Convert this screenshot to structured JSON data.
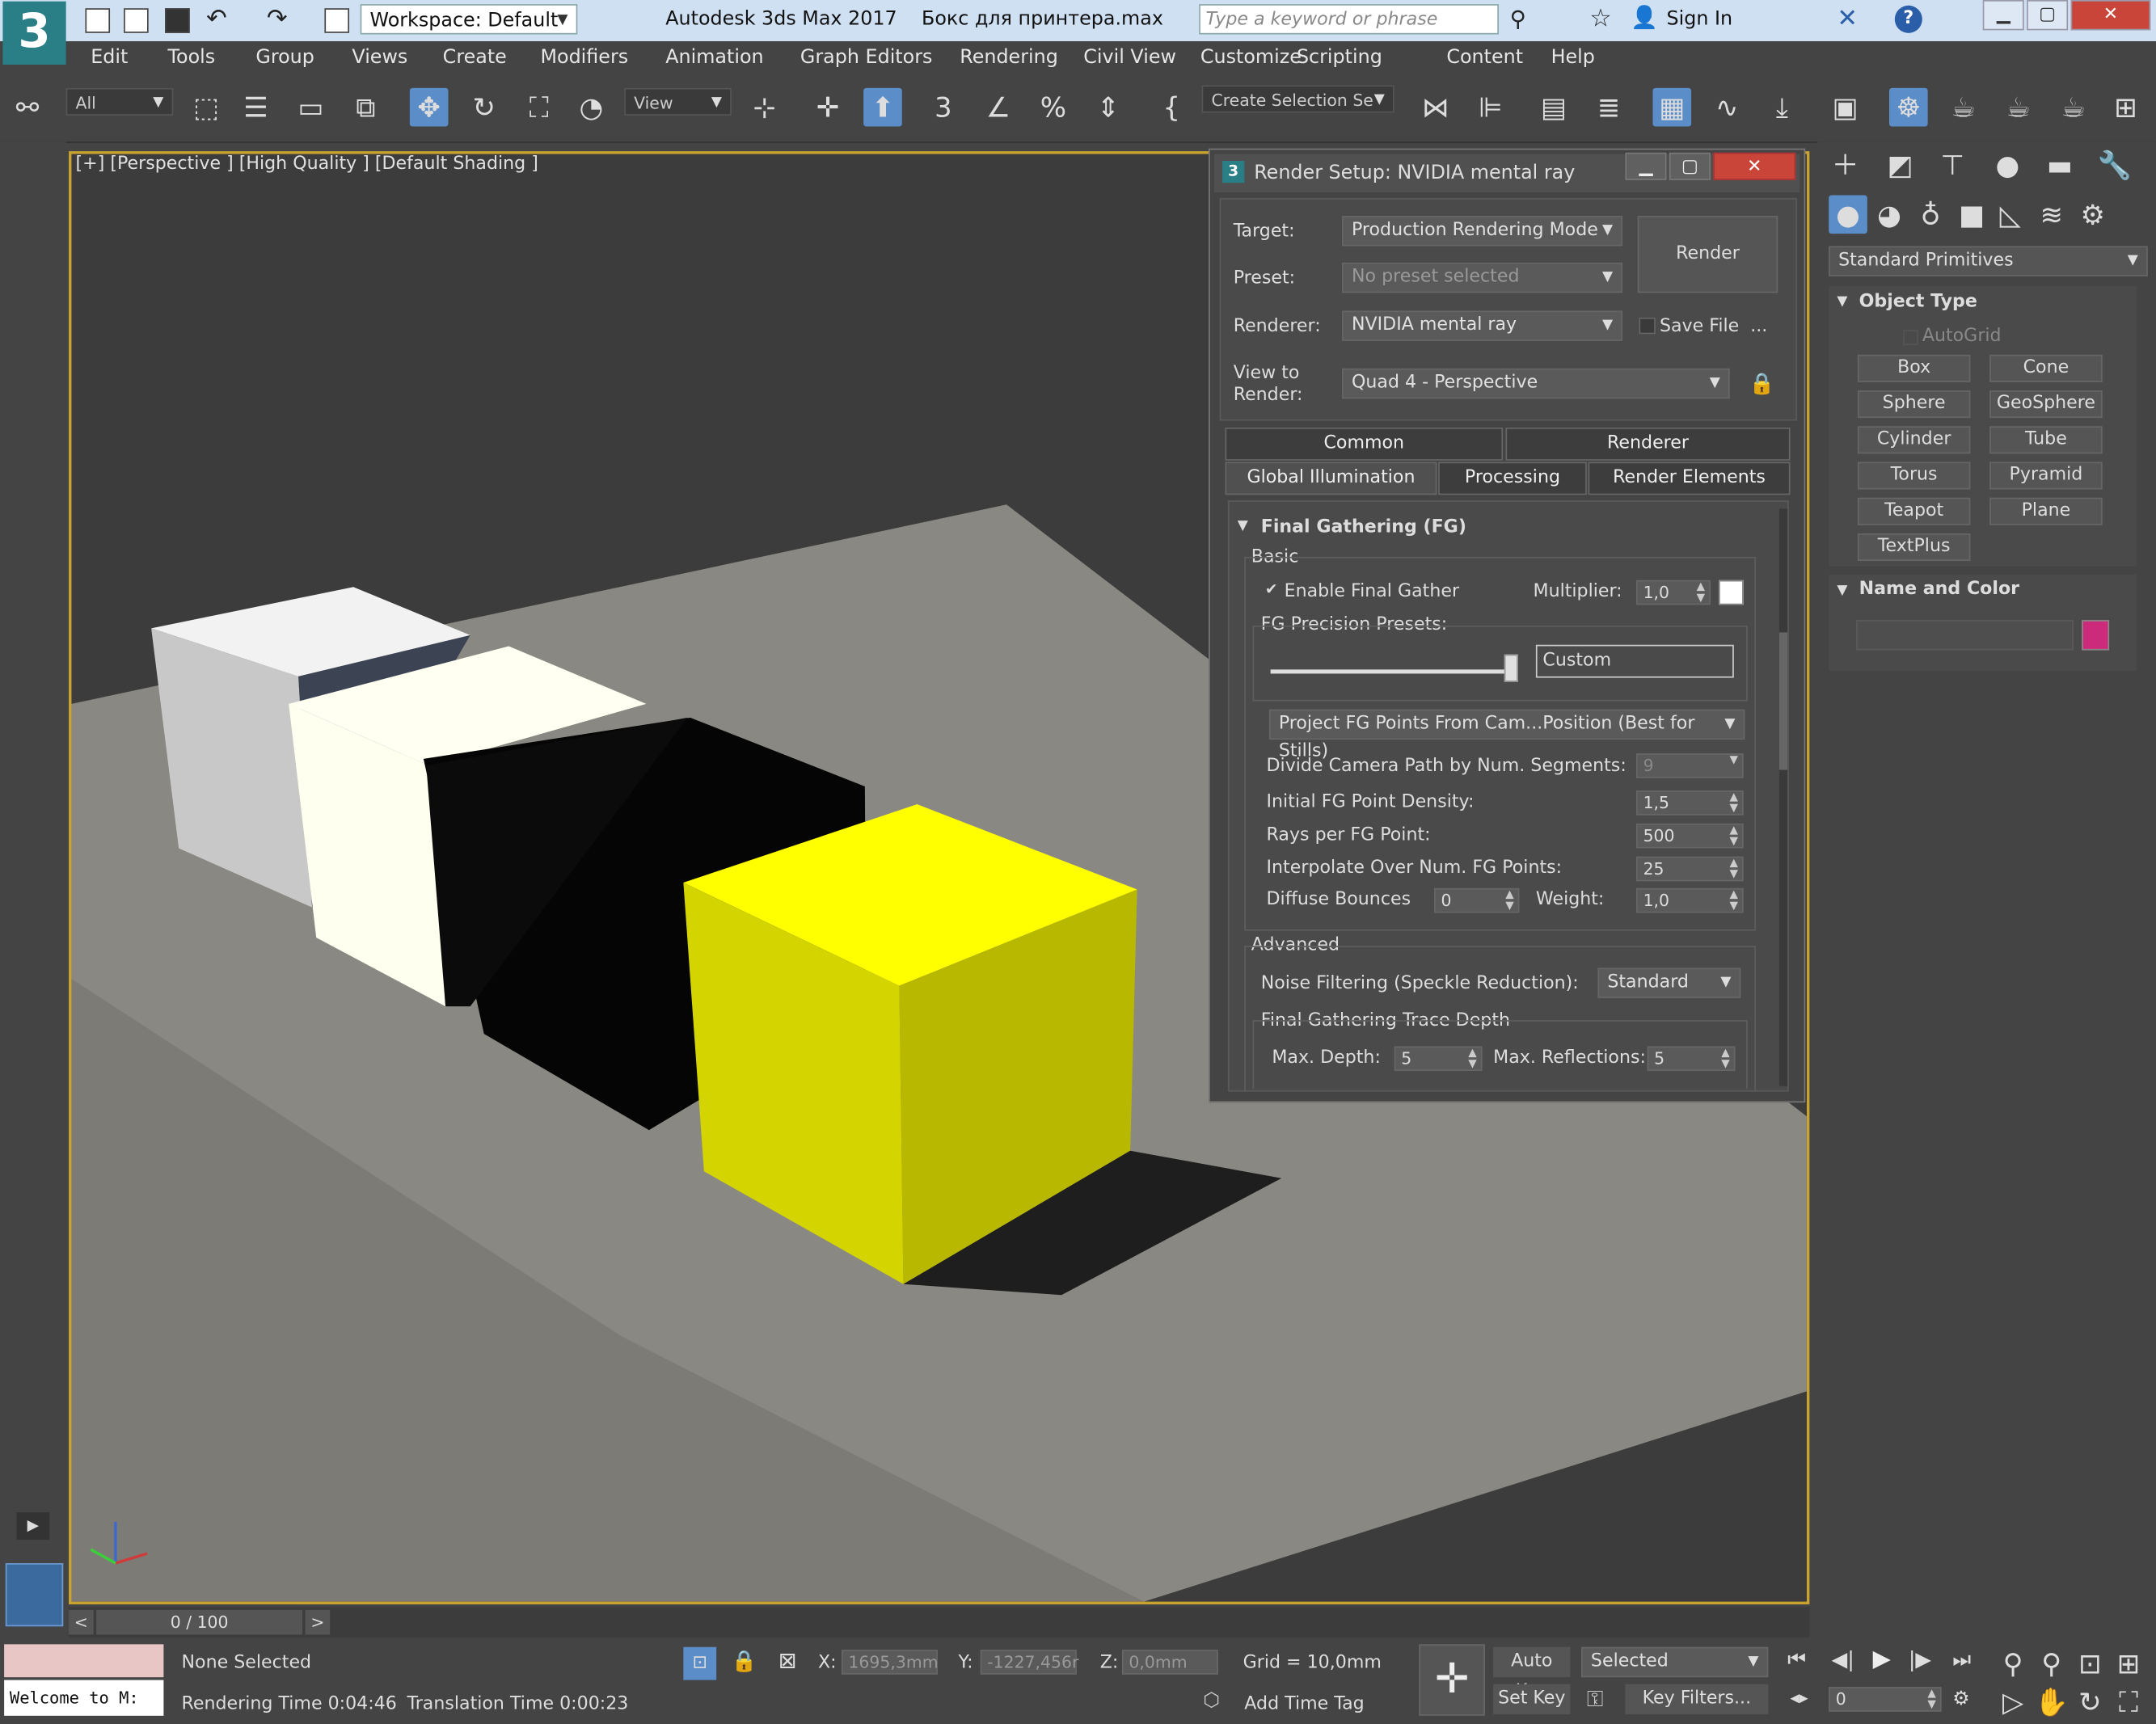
{
  "title_bar": {
    "logo_text": "3",
    "workspace": "Workspace: Default",
    "app_title": "Autodesk 3ds Max 2017",
    "file_title": "Бокс для принтера.max",
    "search_placeholder": "Type a keyword or phrase",
    "sign_in": "Sign In",
    "help": "?"
  },
  "menu": [
    "Edit",
    "Tools",
    "Group",
    "Views",
    "Create",
    "Modifiers",
    "Animation",
    "Graph Editors",
    "Rendering",
    "Civil View",
    "Customize",
    "Scripting",
    "Content",
    "Help"
  ],
  "toolbar": {
    "filter": "All",
    "ref_coord": "View",
    "selection_set": "Create Selection Se"
  },
  "viewport": {
    "label": "[+] [Perspective ] [High Quality ] [Default Shading ]"
  },
  "render_setup": {
    "title": "Render Setup: NVIDIA mental ray",
    "target_label": "Target:",
    "target_value": "Production Rendering Mode",
    "preset_label": "Preset:",
    "preset_value": "No preset selected",
    "renderer_label": "Renderer:",
    "renderer_value": "NVIDIA mental ray",
    "save_file": "Save File",
    "more": "...",
    "view_label_1": "View to",
    "view_label_2": "Render:",
    "view_value": "Quad 4 - Perspective",
    "render_button": "Render",
    "tabs_row1": [
      "Common",
      "Renderer"
    ],
    "tabs_row2": [
      "Global Illumination",
      "Processing",
      "Render Elements"
    ],
    "active_tab": "Global Illumination",
    "fg_title": "Final Gathering (FG)",
    "basic_label": "Basic",
    "enable_fg": "Enable Final Gather",
    "enable_fg_checked": true,
    "multiplier_label": "Multiplier:",
    "multiplier_value": "1,0",
    "fg_color": "#ffffff",
    "presets_label": "FG Precision Presets:",
    "preset_field": "Custom",
    "preset_slider_fraction": 1.0,
    "project_mode": "Project FG Points From Cam...Position (Best for Stills)",
    "divide_label": "Divide Camera Path by Num. Segments:",
    "divide_value": "9",
    "density_label": "Initial FG Point Density:",
    "density_value": "1,5",
    "rays_label": "Rays per FG Point:",
    "rays_value": "500",
    "interp_label": "Interpolate Over Num. FG Points:",
    "interp_value": "25",
    "bounces_label": "Diffuse Bounces",
    "bounces_value": "0",
    "weight_label": "Weight:",
    "weight_value": "1,0",
    "advanced_label": "Advanced",
    "noise_label": "Noise Filtering (Speckle Reduction):",
    "noise_value": "Standard",
    "trace_label": "Final Gathering Trace Depth",
    "max_depth_label": "Max. Depth:",
    "max_depth_value": "5",
    "max_refl_label": "Max. Reflections:",
    "max_refl_value": "5"
  },
  "command_panel": {
    "category": "Standard Primitives",
    "object_type_title": "Object Type",
    "autogrid": "AutoGrid",
    "buttons": [
      "Box",
      "Cone",
      "Sphere",
      "GeoSphere",
      "Cylinder",
      "Tube",
      "Torus",
      "Pyramid",
      "Teapot",
      "Plane",
      "TextPlus"
    ],
    "name_color_title": "Name and Color",
    "object_color": "#cc2a7a"
  },
  "timeline": {
    "frame": "0 / 100",
    "prev": "<",
    "next": ">"
  },
  "status": {
    "maxscript": "Welcome to M:",
    "selection": "None Selected",
    "rendering_time": "Rendering Time  0:04:46",
    "translation_time": "Translation Time  0:00:23",
    "x_label": "X:",
    "x_value": "1695,3mm",
    "y_label": "Y:",
    "y_value": "-1227,456r",
    "z_label": "Z:",
    "z_value": "0,0mm",
    "grid": "Grid = 10,0mm",
    "add_time_tag": "Add Time Tag",
    "auto_key": "Auto Key",
    "set_key": "Set Key",
    "key_mode": "Selected",
    "key_filters": "Key Filters...",
    "current_frame": "0"
  }
}
